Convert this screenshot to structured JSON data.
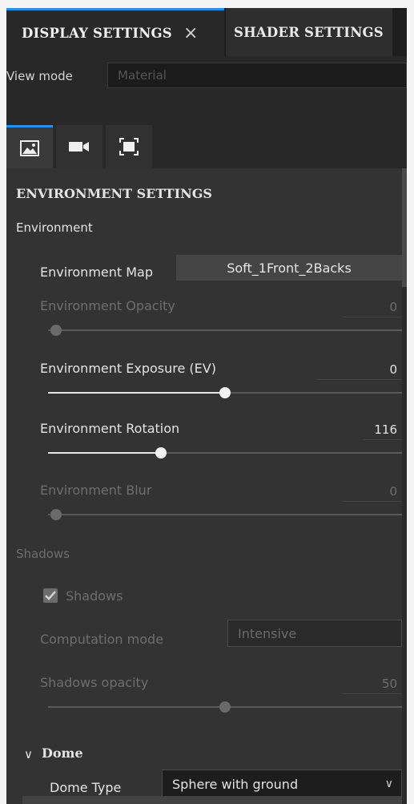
{
  "tabs": {
    "display": "DISPLAY SETTINGS",
    "close_glyph": "×",
    "shader": "SHADER SETTINGS"
  },
  "view_mode": {
    "label": "View mode",
    "placeholder": "Material"
  },
  "icon_tabs": [
    "image-icon",
    "camera-icon",
    "frame-icon"
  ],
  "section": {
    "title": "ENVIRONMENT SETTINGS",
    "environment_group": "Environment",
    "environment_map_label": "Environment Map",
    "environment_map_value": "Soft_1Front_2Backs",
    "opacity_label": "Environment Opacity",
    "opacity_value": "0",
    "opacity_level": 0,
    "exposure_label": "Environment Exposure (EV)",
    "exposure_value": "0",
    "exposure_level": 0.5,
    "rotation_label": "Environment Rotation",
    "rotation_value": "116",
    "rotation_level": 0.32,
    "blur_label": "Environment Blur",
    "blur_value": "0",
    "blur_level": 0,
    "shadows_group": "Shadows",
    "shadows_checkbox_label": "Shadows",
    "shadows_checked": true,
    "computation_label": "Computation mode",
    "computation_value": "Intensive",
    "shadows_opacity_label": "Shadows opacity",
    "shadows_opacity_value": "50",
    "shadows_opacity_level": 0.5,
    "dome_chevron": "∨",
    "dome_title": "Dome",
    "dome_type_label": "Dome Type",
    "dome_type_value": "Sphere with ground",
    "dome_type_chevron": "∨"
  },
  "colors": {
    "accent": "#2f8de4",
    "panel": "#282828",
    "content": "#333333"
  }
}
